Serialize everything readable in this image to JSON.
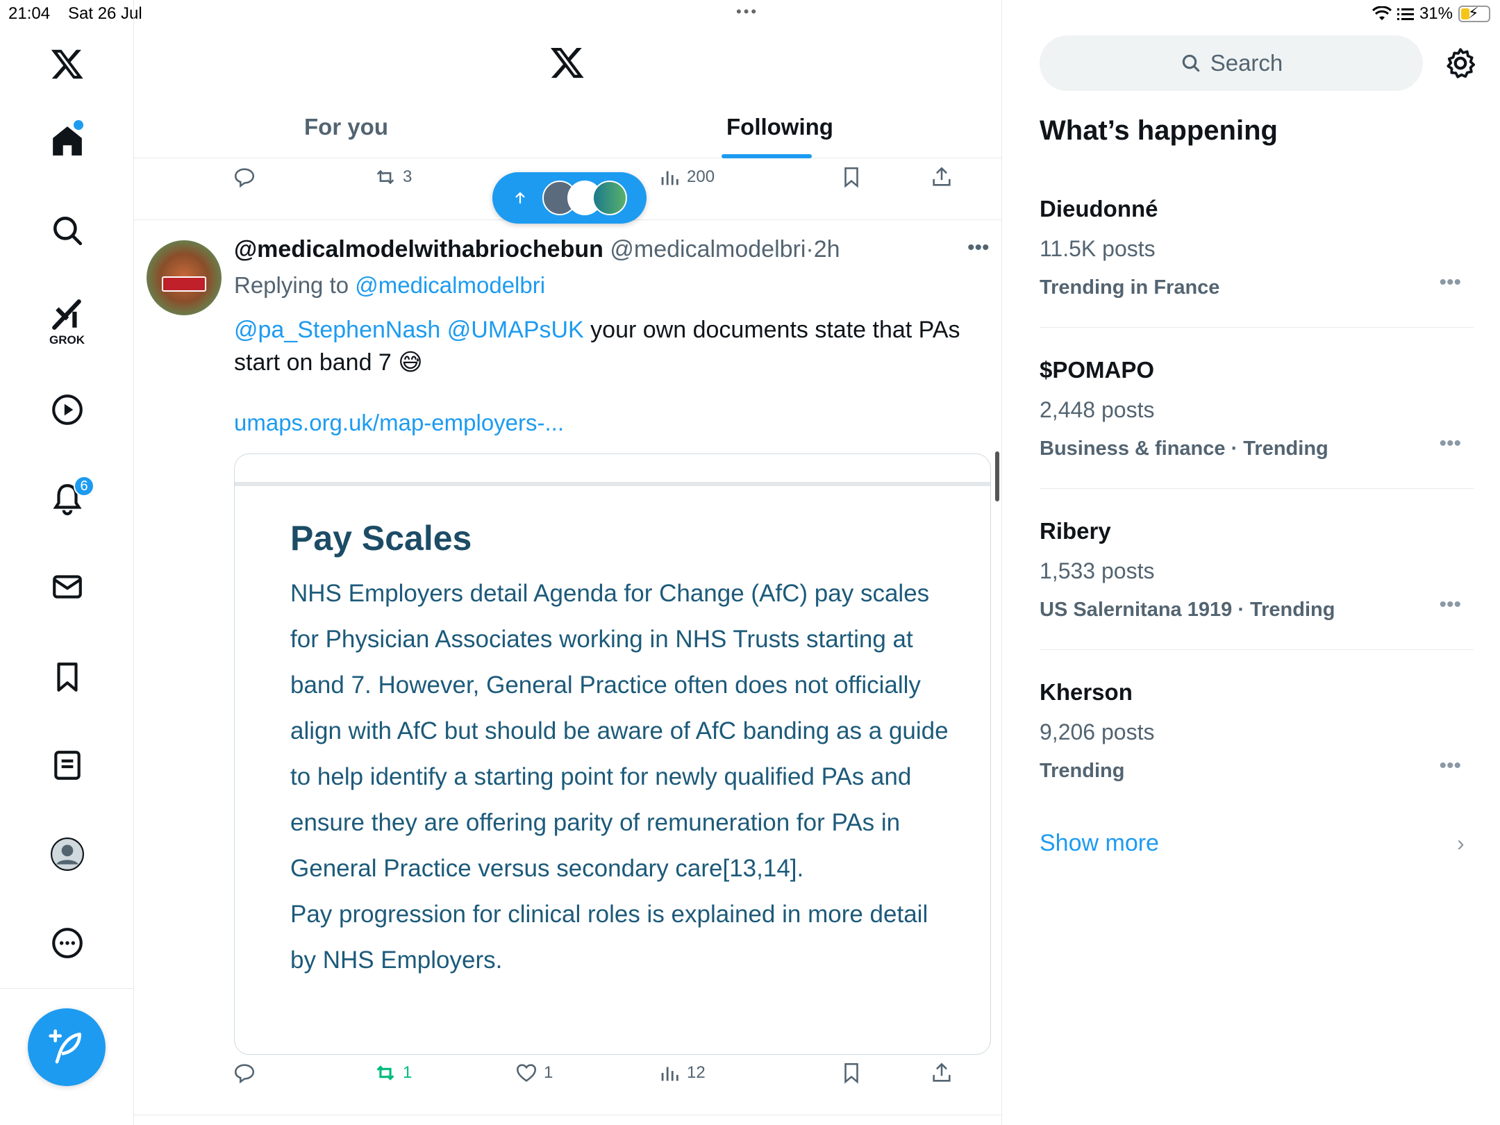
{
  "status_bar": {
    "time": "21:04",
    "date": "Sat 26 Jul",
    "battery": "31%",
    "battery_level": 0.31
  },
  "nav": {
    "grok_label": "GROK",
    "notifications_count": "6"
  },
  "header": {
    "tabs": [
      {
        "label": "For you",
        "selected": false
      },
      {
        "label": "Following",
        "selected": true
      }
    ]
  },
  "prev_tweet_actions": {
    "retweets": "3",
    "views": "200"
  },
  "tweet": {
    "display_name": "@medicalmodelwithabriochebun",
    "handle": "@medicalmodelbri",
    "separator": "·",
    "time": "2h",
    "replying_prefix": "Replying to",
    "replying_to": "@medicalmodelbri",
    "mention1": "@pa_StephenNash",
    "mention2": "@UMAPsUK",
    "text": " your own documents state that PAs start on band 7 ",
    "emoji": "😅",
    "link": "umaps.org.uk/map-employers-...",
    "card": {
      "title": "Pay Scales",
      "body1": "NHS Employers detail Agenda for Change (AfC) pay scales for Physician Associates working in NHS Trusts starting at band 7. However, General Practice often does not officially align with AfC but should be aware of AfC banding as a guide to help identify a starting point for newly qualified PAs and ensure they are offering parity of remuneration for PAs in General Practice versus secondary care[13,14].",
      "body2": "Pay progression for clinical roles is explained in more detail by NHS Employers."
    },
    "actions": {
      "retweets": "1",
      "likes": "1",
      "views": "12"
    }
  },
  "sidebar": {
    "search_placeholder": "Search",
    "title": "What’s happening",
    "trends": [
      {
        "name": "Dieudonné",
        "count": "11.5K posts",
        "context": "Trending in France"
      },
      {
        "name": "$POMAPO",
        "count": "2,448 posts",
        "context": "Business & finance · Trending"
      },
      {
        "name": "Ribery",
        "count": "1,533 posts",
        "context": "US Salernitana 1919 · Trending"
      },
      {
        "name": "Kherson",
        "count": "9,206 posts",
        "context": "Trending"
      }
    ],
    "show_more": "Show more"
  },
  "colors": {
    "accent": "#1d9bf0",
    "retweet_active": "#00ba7c",
    "card_title": "#1c4c66",
    "card_text": "#1c5a7a"
  }
}
